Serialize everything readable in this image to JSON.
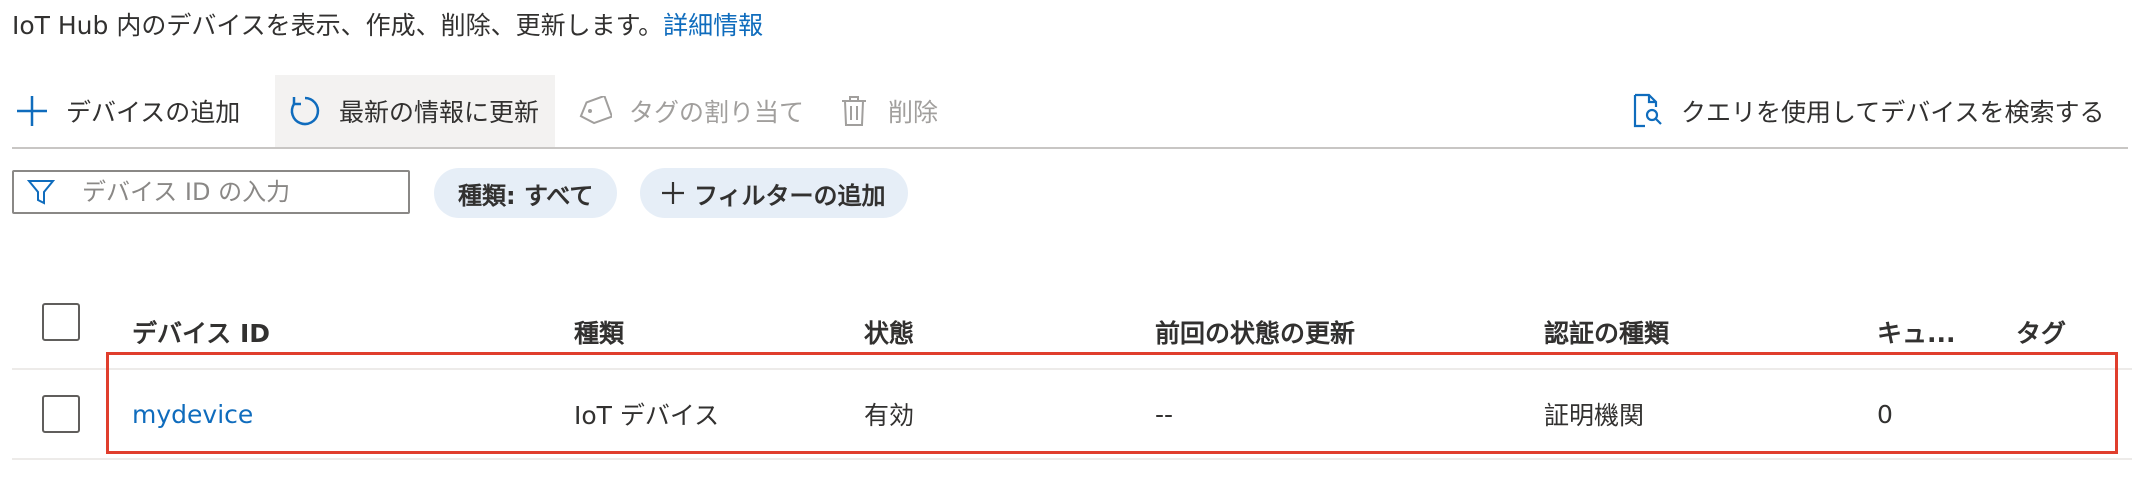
{
  "intro": {
    "text": "IoT Hub 内のデバイスを表示、作成、削除、更新します。",
    "link": "詳細情報"
  },
  "toolbar": {
    "add_device": "デバイスの追加",
    "refresh": "最新の情報に更新",
    "assign_tags": "タグの割り当て",
    "delete": "削除",
    "query_devices": "クエリを使用してデバイスを検索する"
  },
  "filter": {
    "placeholder": "デバイス ID の入力",
    "type_pill": "種類: すべて",
    "add_filter": "フィルターの追加"
  },
  "table": {
    "columns": {
      "device_id": "デバイス ID",
      "type": "種類",
      "status": "状態",
      "last_status_update": "前回の状態の更新",
      "auth_type": "認証の種類",
      "queue": "キュ...",
      "tags": "タグ"
    },
    "rows": [
      {
        "device_id": "mydevice",
        "type": "IoT デバイス",
        "status": "有効",
        "last_status_update": "--",
        "auth_type": "証明機関",
        "queue": "0",
        "tags": ""
      }
    ]
  },
  "colors": {
    "accent": "#0f6cbd",
    "highlight": "#e03e2d",
    "pill_bg": "#e6eef7"
  }
}
